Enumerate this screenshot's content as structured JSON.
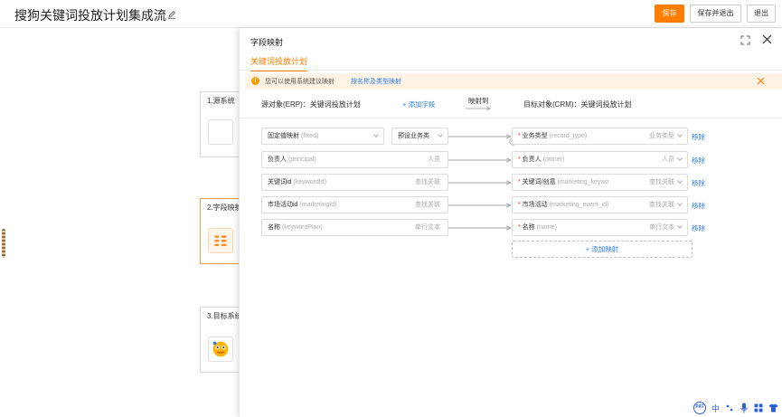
{
  "header": {
    "title": "搜狗关键词投放计划集成流",
    "save_label": "保存",
    "save_exit_label": "保存并退出",
    "exit_label": "退出"
  },
  "flow": {
    "nodes": [
      {
        "label": "1.源系统"
      },
      {
        "label": "2.字段映射"
      },
      {
        "label": "3.目标系统"
      }
    ]
  },
  "panel": {
    "title": "字段映射",
    "tab_label": "关键词投放计划",
    "notice_text": "您可以使用系统建议映射",
    "notice_link": "按名称及类型映射",
    "source_title": "源对象(ERP)：关键词投放计划",
    "add_field_label": "+ 添加字段",
    "map_to_label": "映射到",
    "target_title": "目标对象(CRM)：关键词投放计划",
    "fixed_row": {
      "source_label": "固定值映射",
      "source_api": "(fixed)",
      "preset_label": "预设业务类",
      "target_label": "业务类型",
      "target_api": "(record_type)",
      "target_hint": "业务类型",
      "remove_label": "移除"
    },
    "rows": [
      {
        "source_label": "负责人",
        "source_api": "(principal)",
        "source_hint": "人员",
        "target_label": "负责人",
        "target_api": "(owner)",
        "target_hint": "人员",
        "remove_label": "移除"
      },
      {
        "source_label": "关键词id",
        "source_api": "(keywordId)",
        "source_hint": "查找关联",
        "target_label": "关键词/创意",
        "target_api": "(marketing_keywo",
        "target_hint": "查找关联",
        "remove_label": "移除"
      },
      {
        "source_label": "市场活动id",
        "source_api": "(marketingId)",
        "source_hint": "查找关联",
        "target_label": "市场活动",
        "target_api": "(marketing_event_id)",
        "target_hint": "查找关联",
        "remove_label": "移除"
      },
      {
        "source_label": "名称",
        "source_api": "(keywordPlan)",
        "source_hint": "单行文本",
        "target_label": "名称",
        "target_api": "(name)",
        "target_hint": "单行文本",
        "remove_label": "移除"
      }
    ],
    "add_mapping_label": "+ 添加映射"
  },
  "ime": {
    "badge": "PAT",
    "lang": "中"
  },
  "colors": {
    "accent": "#ff7d00",
    "link": "#2f7fe6",
    "notice_bg": "#fff3e6"
  }
}
